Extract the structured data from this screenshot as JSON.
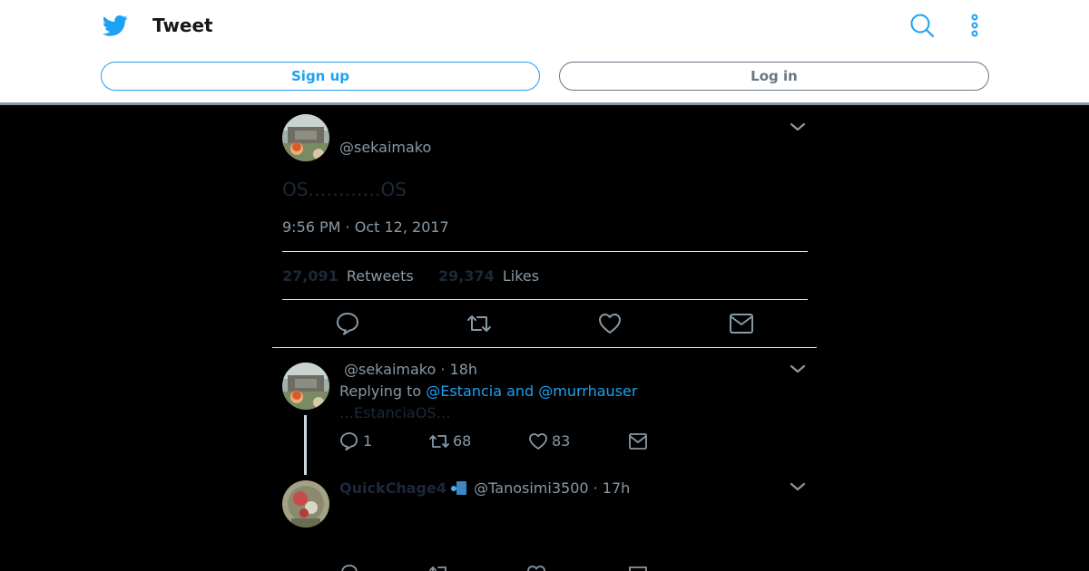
{
  "header": {
    "title": "Tweet",
    "signup_label": "Sign up",
    "login_label": "Log in"
  },
  "main_tweet": {
    "handle": "@sekaimako",
    "text": "OS…………OS",
    "timestamp": "9:56 PM · Oct 12, 2017",
    "retweet_count": "27,091",
    "retweet_label": "Retweets",
    "like_count": "29,374",
    "like_label": "Likes"
  },
  "replies": [
    {
      "handle_time": "@sekaimako · 18h",
      "replying_prefix": "Replying to",
      "replying_to": "@Estancia and @murrhauser",
      "text": "…EstanciaOS…",
      "reply_count": "1",
      "retweet_count": "68",
      "like_count": "83"
    },
    {
      "display_name": "QuickChage4",
      "handle_time": "@Tanosimi3500 · 17h"
    }
  ],
  "icons": {
    "logo": "twitter-bird-icon",
    "search": "search-icon",
    "more": "more-vertical-icon",
    "reply": "reply-icon",
    "retweet": "retweet-icon",
    "like": "heart-icon",
    "dm": "envelope-icon",
    "caret": "chevron-down-icon"
  },
  "colors": {
    "accent": "#1da1f2",
    "muted": "#8899a6",
    "background": "#000000"
  }
}
